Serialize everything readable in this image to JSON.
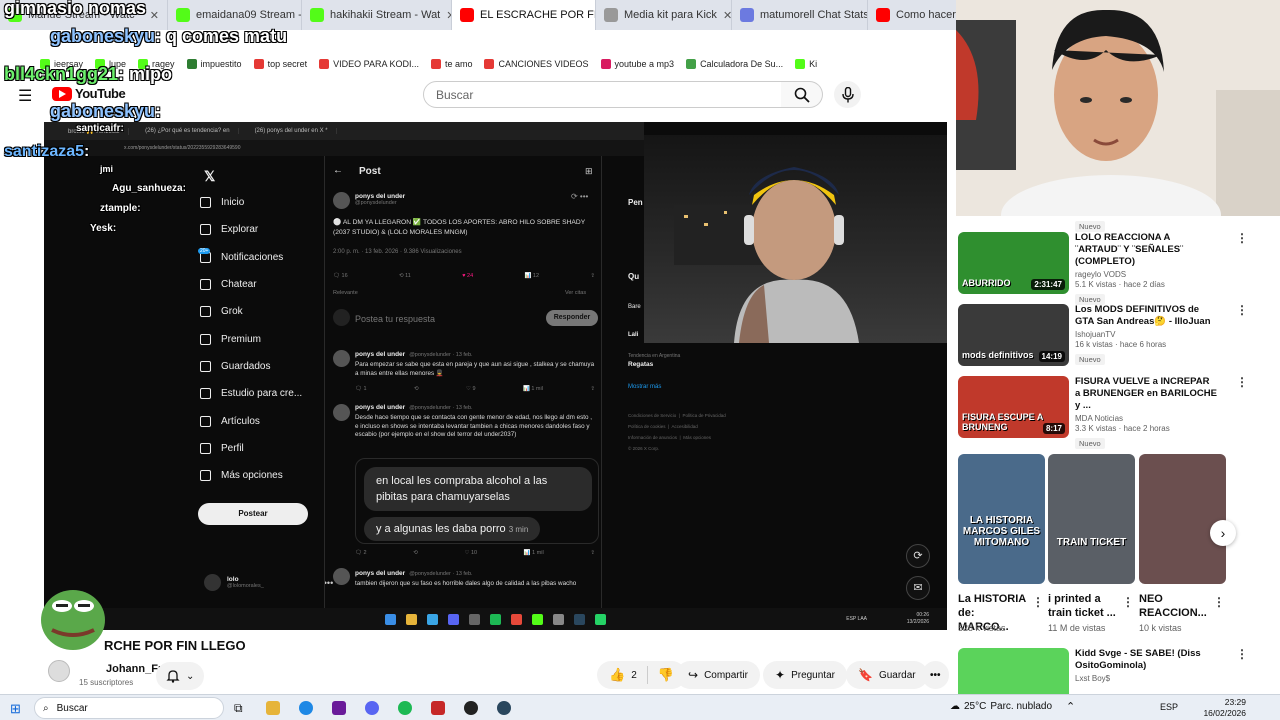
{
  "browser": {
    "tabs": [
      {
        "label": "Manue Stream - Watc",
        "color": "#53fc18"
      },
      {
        "label": "emaidana09 Stream - W",
        "color": "#53fc18"
      },
      {
        "label": "hakihakii Stream - Wat",
        "color": "#53fc18"
      },
      {
        "label": "EL ESCRACHE POR FIN LLEG",
        "color": "#ff0000"
      },
      {
        "label": "Media kit para Kick",
        "color": "#999999"
      },
      {
        "label": "matumorell Chat Stats on T",
        "color": "#6c7ae0"
      },
      {
        "label": "Como hacer un MED",
        "color": "#ff0000"
      }
    ],
    "close_glyph": "✕",
    "bookmarks": [
      {
        "label": "ieersay",
        "color": "#53fc18"
      },
      {
        "label": "lupe",
        "color": "#53fc18"
      },
      {
        "label": "ragey",
        "color": "#53fc18"
      },
      {
        "label": "impuestito",
        "color": "#2e7d32"
      },
      {
        "label": "top secret",
        "color": "#e53935"
      },
      {
        "label": "VIDEO PARA KODI...",
        "color": "#e53935"
      },
      {
        "label": "te amo",
        "color": "#e53935"
      },
      {
        "label": "CANCIONES VIDEOS",
        "color": "#e53935"
      },
      {
        "label": "youtube a mp3",
        "color": "#d81b60"
      },
      {
        "label": "Calculadora De Su...",
        "color": "#43a047"
      },
      {
        "label": "Ki",
        "color": "#53fc18"
      }
    ]
  },
  "youtube": {
    "logo_text": "YouTube",
    "search_placeholder": "Buscar",
    "video_title": "EL ESCRACHE POR FIN LLEGO",
    "video_title_visible": "RCHE POR FIN LLEGO",
    "channel_name": "Johann_Fr",
    "subscribers": "15 suscriptores",
    "like_count": "2",
    "actions": {
      "share": "Compartir",
      "ask": "Preguntar",
      "save": "Guardar"
    }
  },
  "chat_overlay": {
    "messages": [
      {
        "user": "gimnasio nomas",
        "text": "",
        "color": "#ffffff"
      },
      {
        "user": "gaboneskyu",
        "text": ": q comes matu",
        "color": "#8fc3ff"
      },
      {
        "user": "bll4ckn1gg21",
        "text": ": mipo",
        "color": "#6cf06c"
      },
      {
        "user": "gaboneskyu",
        "text": ":",
        "color": "#8fc3ff"
      },
      {
        "user": "santicaifr",
        "text": ":",
        "color": "#ffffff"
      },
      {
        "user": "santizaza5",
        "text": ":",
        "color": "#6cb6ff"
      },
      {
        "user": "jmi",
        "text": "",
        "color": "#ffffff"
      },
      {
        "user": "Agu_sanhueza",
        "text": ":",
        "color": "#ffffff"
      },
      {
        "user": "ztample",
        "text": ":",
        "color": "#ffffff"
      },
      {
        "user": "Yesk",
        "text": ":",
        "color": "#ffffff"
      }
    ]
  },
  "x_app": {
    "inner_tabs": [
      "brotito 🙌 #enzocor",
      "(26) ¿Por qué es tendencia? en",
      "(26) ponys del under en X *"
    ],
    "inner_url": "x.com/ponysdelunder/status/2022355929283649590",
    "nav": [
      "Inicio",
      "Explorar",
      "Notificaciones",
      "Chatear",
      "Grok",
      "Premium",
      "Guardados",
      "Estudio para cre...",
      "Artículos",
      "Perfil",
      "Más opciones"
    ],
    "notif_badge": "20+",
    "post_button": "Postear",
    "profile_name": "lolo",
    "profile_handle": "@lolomorales_",
    "header": "Post",
    "main_post": {
      "author": "ponys del under",
      "handle": "@ponysdelunder",
      "text": "⚪ AL DM YA LLEGARON ✅ TODOS LOS APORTES: ABRO HILO SOBRE SHADY (2037 STUDIO) & (LOLO MORALES MNGM)",
      "timestamp": "2:00 p. m. · 13 feb. 2026 · 9.386 Visualizaciones",
      "replies": "16",
      "reposts": "11",
      "likes": "24",
      "bookmarks": "12",
      "relevant": "Relevante",
      "quotes": "Ver citas"
    },
    "reply_placeholder": "Postea tu respuesta",
    "reply_button": "Responder",
    "replies": [
      {
        "author": "ponys del under",
        "handle": "@ponysdelunder · 13 feb.",
        "text": "Para empezar se sabe que esta en pareja y que aun asi sigue , stalkea y se chamuya a minas entre ellas menores 💂",
        "stats": [
          "1",
          "",
          "9",
          "1 mil"
        ]
      },
      {
        "author": "ponys del under",
        "handle": "@ponysdelunder · 13 feb.",
        "text": "Desde hace tiempo que se contacta con gente menor de edad, nos llego al dm esto , e incluso en shows se intentaba levantar tambien a chicas menores dandoles faso y escabio (por ejemplo en el show del terror del under2037)",
        "dm1": "en local les compraba alcohol a las pibitas para chamuyarselas",
        "dm2": "y a algunas les daba porro",
        "dm2_time": "3 min",
        "stats": [
          "2",
          "",
          "10",
          "1 mil"
        ]
      },
      {
        "author": "ponys del under",
        "handle": "@ponysdelunder · 13 feb.",
        "text": "tambien dijeron que su faso es horrible dales algo de calidad a las pibas wacho"
      }
    ],
    "right": {
      "premium_header": "Pen",
      "trends_header": "Qu",
      "trend_label": "Tendencia en Argentina",
      "trend_name": "Regatas",
      "show_more": "Mostrar más",
      "footer": [
        "Condiciones de Servicio",
        "Política de Privacidad",
        "Política de cookies",
        "Accesibilidad",
        "Información de anuncios",
        "Más opciones",
        "© 2026 X Corp."
      ],
      "partial1": "Bare",
      "partial2": "Lali"
    },
    "inner_taskbar_lang": "ESP LAA",
    "inner_taskbar_time": "00:26",
    "inner_taskbar_date": "13/2/2026"
  },
  "recommendations": {
    "top_badge": "Nuevo",
    "items": [
      {
        "title": "LOLO REACCIONA A ¨ARTAUD¨ Y ¨SEÑALES¨ (COMPLETO)",
        "channel": "rageylo VODS",
        "views": "5.1 K vistas · hace 2 días",
        "badge": "Nuevo",
        "duration": "2:31:47",
        "thumb_color": "#2f8f2f",
        "thumb_text": "ABURRIDO"
      },
      {
        "title": "Los MODS DEFINITIVOS de GTA San Andreas🤔 - IlloJuan",
        "channel": "IshojuanTV",
        "views": "16 k vistas · hace 6 horas",
        "badge": "Nuevo",
        "duration": "14:19",
        "thumb_color": "#3a3a3a",
        "thumb_text": "mods definitivos"
      },
      {
        "title": "FISURA VUELVE a INCREPAR a BRUNENGER en BARILOCHE y ...",
        "channel": "MDA Noticias",
        "views": "3.3 K vistas · hace 2 horas",
        "badge": "Nuevo",
        "duration": "8:17",
        "thumb_color": "#c0392b",
        "thumb_text": "FISURA ESCUPE A BRUNENG"
      }
    ],
    "shorts": [
      {
        "title": "La HISTORIA de: MARCO...",
        "views": "528 k vistas",
        "overlay": "LA HISTORIA MARCOS GILES MITOMANO",
        "color": "#4a6a8a"
      },
      {
        "title": "i printed a train ticket ...",
        "views": "11 M de vistas",
        "overlay": "TRAIN TICKET",
        "color": "#5a5f66"
      },
      {
        "title": "NEO REACCION...",
        "views": "10 k vistas",
        "overlay": "",
        "color": "#6b4f4f"
      }
    ],
    "last": {
      "title": "Kidd Svge - SE SABE! (Diss OsitoGominola)",
      "channel": "Lxst Boy$",
      "thumb_color": "#5bd35b"
    }
  },
  "taskbar": {
    "search_label": "Buscar",
    "weather_temp": "25°C",
    "weather_text": "Parc. nublado",
    "lang": "ESP",
    "time": "23:29",
    "date": "16/02/2026"
  }
}
